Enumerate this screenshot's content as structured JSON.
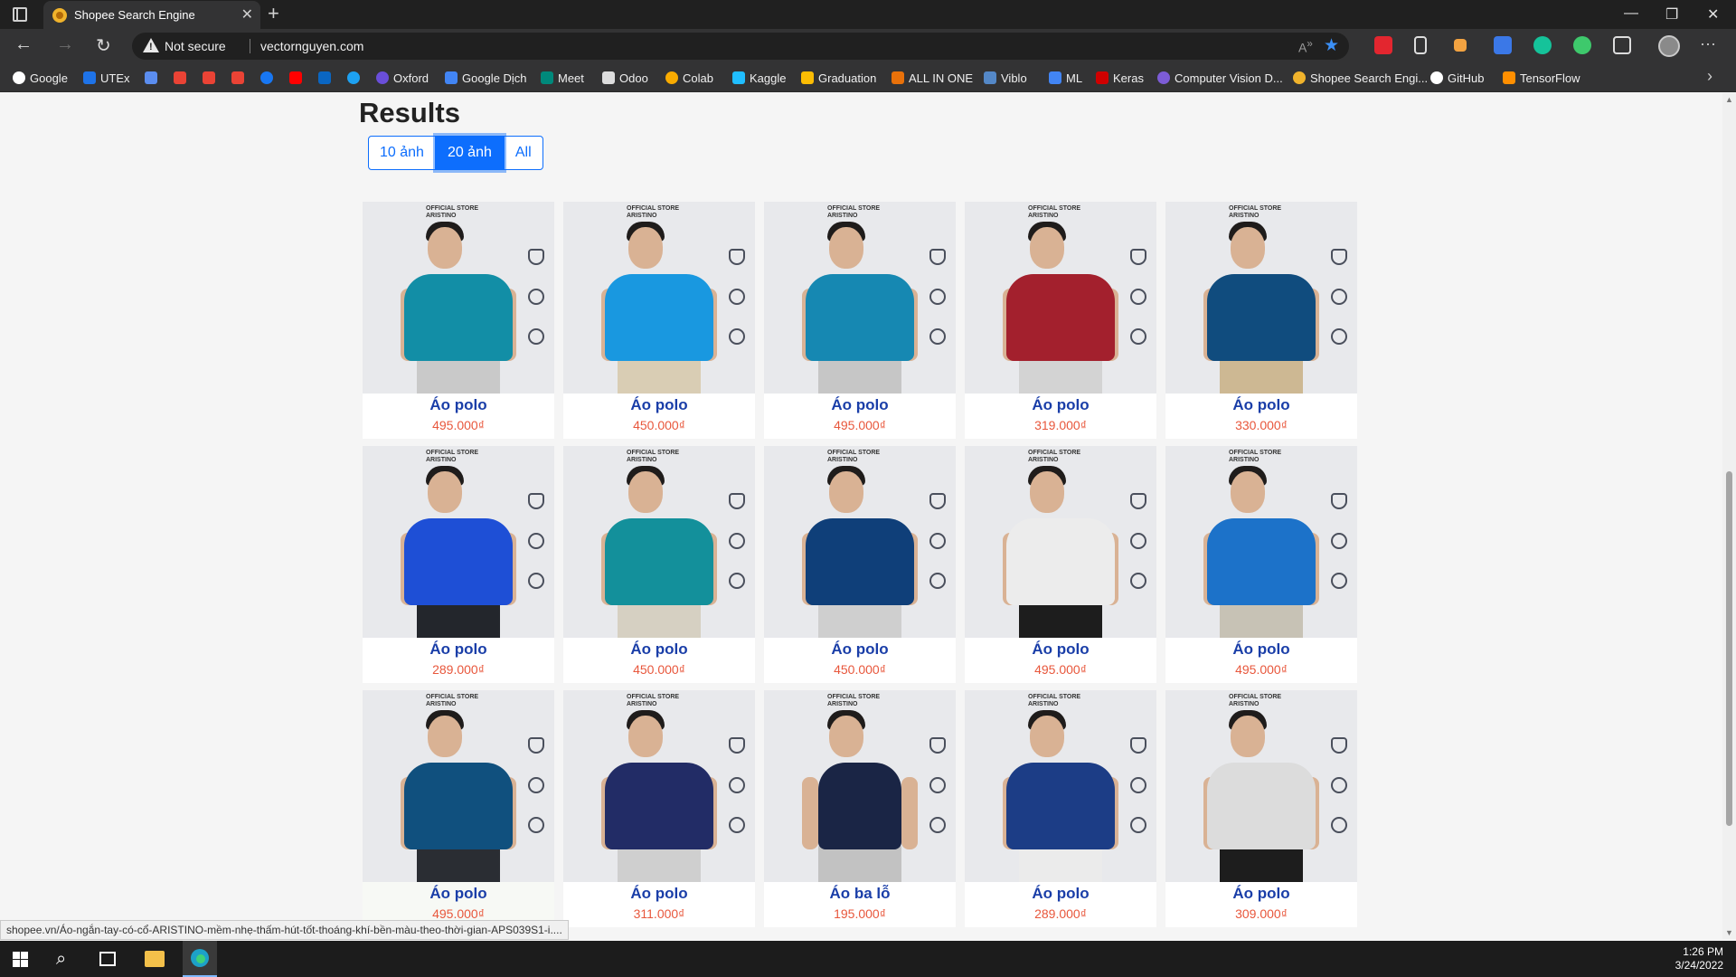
{
  "browser": {
    "tab_title": "Shopee Search Engine",
    "security_label": "Not secure",
    "url": "vectornguyen.com",
    "bookmarks": [
      {
        "label": "Google",
        "color": "#ffffff"
      },
      {
        "label": "UTEx",
        "color": "#1e73e8"
      },
      {
        "label": "",
        "color": "#5b8def"
      },
      {
        "label": "",
        "color": "#ea4335"
      },
      {
        "label": "",
        "color": "#ea4335"
      },
      {
        "label": "",
        "color": "#ea4335"
      },
      {
        "label": "",
        "color": "#1877f2"
      },
      {
        "label": "",
        "color": "#ff0000"
      },
      {
        "label": "",
        "color": "#0a66c2"
      },
      {
        "label": "",
        "color": "#1da1f2"
      },
      {
        "label": "Oxford",
        "color": "#6a4ed9"
      },
      {
        "label": "Google Dịch",
        "color": "#4285f4"
      },
      {
        "label": "Meet",
        "color": "#00897b"
      },
      {
        "label": "Odoo",
        "color": "#dddddd"
      },
      {
        "label": "Colab",
        "color": "#f9ab00"
      },
      {
        "label": "Kaggle",
        "color": "#20beff"
      },
      {
        "label": "Graduation",
        "color": "#fbbc04"
      },
      {
        "label": "ALL IN ONE",
        "color": "#e8710a"
      },
      {
        "label": "Viblo",
        "color": "#5488c7"
      },
      {
        "label": "ML",
        "color": "#4285f4"
      },
      {
        "label": "Keras",
        "color": "#d00000"
      },
      {
        "label": "Computer Vision D...",
        "color": "#7c5cd6"
      },
      {
        "label": "Shopee Search Engi...",
        "color": "#f0b32c"
      },
      {
        "label": "GitHub",
        "color": "#ffffff"
      },
      {
        "label": "TensorFlow",
        "color": "#ff8f00"
      }
    ],
    "status_url": "shopee.vn/Áo-ngắn-tay-có-cổ-ARISTINO-mềm-nhẹ-thấm-hút-tốt-thoáng-khí-bền-màu-theo-thời-gian-APS039S1-i...."
  },
  "page": {
    "title": "Results",
    "filter_buttons": [
      "10 ảnh",
      "20 ảnh",
      "All"
    ],
    "active_filter": "20 ảnh",
    "products": [
      {
        "name": "Áo polo",
        "price": "495.000₫",
        "shirt": "#128ea6",
        "pants": "#c9c9c9"
      },
      {
        "name": "Áo polo",
        "price": "450.000₫",
        "shirt": "#1998e0",
        "pants": "#d9cdb4"
      },
      {
        "name": "Áo polo",
        "price": "495.000₫",
        "shirt": "#1688b2",
        "pants": "#c6c6c6"
      },
      {
        "name": "Áo polo",
        "price": "319.000₫",
        "shirt": "#a3202d",
        "pants": "#d3d3d3"
      },
      {
        "name": "Áo polo",
        "price": "330.000₫",
        "shirt": "#104c7e",
        "pants": "#cdb893"
      },
      {
        "name": "Áo polo",
        "price": "289.000₫",
        "shirt": "#1e4fd6",
        "pants": "#23262c"
      },
      {
        "name": "Áo polo",
        "price": "450.000₫",
        "shirt": "#13909b",
        "pants": "#d6d0c2"
      },
      {
        "name": "Áo polo",
        "price": "450.000₫",
        "shirt": "#0f3f79",
        "pants": "#cfcfcf"
      },
      {
        "name": "Áo polo",
        "price": "495.000₫",
        "shirt": "#ececec",
        "pants": "#1d1d1d"
      },
      {
        "name": "Áo polo",
        "price": "495.000₫",
        "shirt": "#1c72c9",
        "pants": "#c7c2b5"
      },
      {
        "name": "Áo polo",
        "price": "495.000₫",
        "shirt": "#10507e",
        "pants": "#2a2d33"
      },
      {
        "name": "Áo polo",
        "price": "311.000₫",
        "shirt": "#222c66",
        "pants": "#cfcfcf"
      },
      {
        "name": "Áo ba lỗ",
        "price": "195.000₫",
        "shirt": "#1a2545",
        "pants": "#c2c2c2"
      },
      {
        "name": "Áo polo",
        "price": "289.000₫",
        "shirt": "#1c3d86",
        "pants": "#ebebeb"
      },
      {
        "name": "Áo polo",
        "price": "309.000₫",
        "shirt": "#dcdcdc",
        "pants": "#1d1d1d"
      }
    ],
    "brand_text": "ARISTINO",
    "store_text": "OFFICIAL STORE"
  },
  "taskbar": {
    "time": "1:26 PM",
    "date": "3/24/2022"
  },
  "colors": {
    "accent": "#0d6efd",
    "product_name": "#1a3ea8",
    "price": "#e8573c"
  }
}
